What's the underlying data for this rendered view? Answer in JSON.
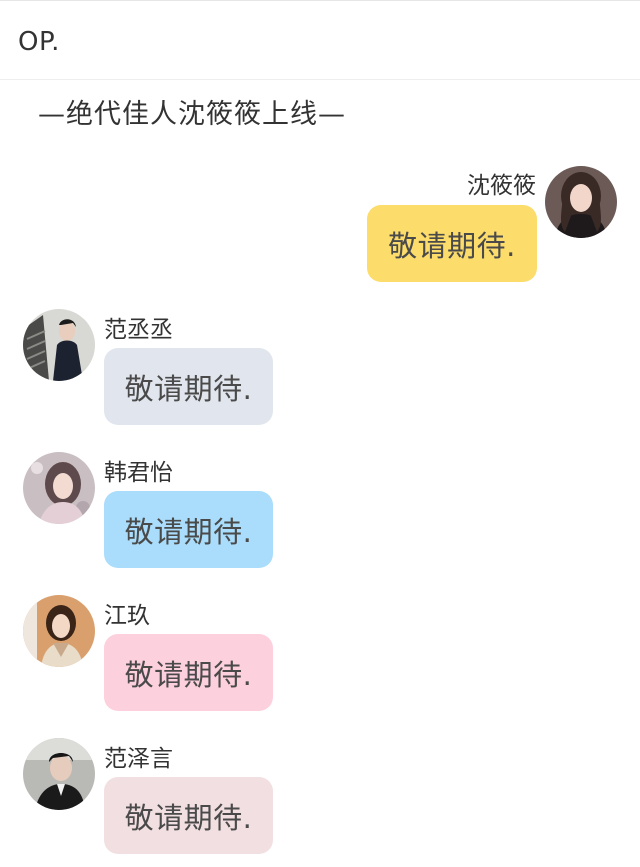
{
  "header": {
    "title": "OP."
  },
  "subtitle": "—绝代佳人沈筱筱上线—",
  "messages": [
    {
      "sender": "沈筱筱",
      "text": "敬请期待.",
      "side": "right",
      "bubble_color": "#fcdc6b",
      "avatar_icon": "woman-portrait-icon"
    },
    {
      "sender": "范丞丞",
      "text": "敬请期待.",
      "side": "left",
      "bubble_color": "#e1e6ee",
      "avatar_icon": "man-portrait-icon"
    },
    {
      "sender": "韩君怡",
      "text": "敬请期待.",
      "side": "left",
      "bubble_color": "#a9ddfb",
      "avatar_icon": "woman-portrait-icon"
    },
    {
      "sender": "江玖",
      "text": "敬请期待.",
      "side": "left",
      "bubble_color": "#fdd0dd",
      "avatar_icon": "woman-portrait-icon"
    },
    {
      "sender": "范泽言",
      "text": "敬请期待.",
      "side": "left",
      "bubble_color": "#f2dfe1",
      "avatar_icon": "man-portrait-icon"
    }
  ]
}
